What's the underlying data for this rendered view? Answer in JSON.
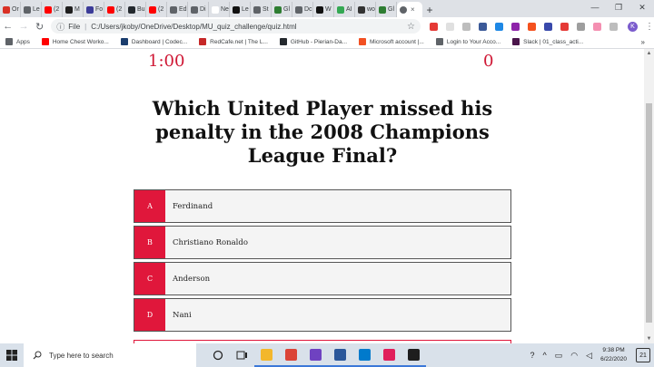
{
  "browser": {
    "tabs": [
      {
        "label": "Or",
        "color": "#d93025"
      },
      {
        "label": "Le",
        "color": "#5f6368"
      },
      {
        "label": "(2",
        "color": "#ff0000"
      },
      {
        "label": "M",
        "color": "#1f1f1f"
      },
      {
        "label": "Fo",
        "color": "#3b3b98"
      },
      {
        "label": "(2",
        "color": "#ff0000"
      },
      {
        "label": "Bu",
        "color": "#24292e"
      },
      {
        "label": "(2",
        "color": "#ff0000"
      },
      {
        "label": "Ed",
        "color": "#5f6368"
      },
      {
        "label": "Di",
        "color": "#5f6368"
      },
      {
        "label": "New T",
        "color": "#ffffff"
      },
      {
        "label": "Le",
        "color": "#111111"
      },
      {
        "label": "St",
        "color": "#5f6368"
      },
      {
        "label": "Gl",
        "color": "#2e7d32"
      },
      {
        "label": "Dc",
        "color": "#5f6368"
      },
      {
        "label": "W",
        "color": "#111111"
      },
      {
        "label": "AI",
        "color": "#34a853"
      },
      {
        "label": "wo",
        "color": "#333333"
      },
      {
        "label": "Gl",
        "color": "#2e7d32"
      }
    ],
    "active_tab": {
      "label": "",
      "close": "×"
    },
    "new_tab": "+",
    "url_label": "File",
    "url": "C:/Users/jkoby/OneDrive/Desktop/MU_quiz_challenge/quiz.html",
    "avatar": "K",
    "bookmarks": [
      {
        "label": "Apps",
        "color": "#5f6368"
      },
      {
        "label": "Home Chest Worko...",
        "color": "#ff0000"
      },
      {
        "label": "Dashboard | Codec...",
        "color": "#1a3d6d"
      },
      {
        "label": "RedCafe.net | The L...",
        "color": "#c62828"
      },
      {
        "label": "GitHub - Pierian-Da...",
        "color": "#24292e"
      },
      {
        "label": "Microsoft account |...",
        "color": "#f25022"
      },
      {
        "label": "Login to Your Acco...",
        "color": "#5f6368"
      },
      {
        "label": "Slack | 01_class_acti...",
        "color": "#4a154b"
      }
    ],
    "bookmarks_more": "»"
  },
  "quiz": {
    "timer": "1:00",
    "score": "0",
    "question": "Which United Player missed his penalty in the 2008 Champions League Final?",
    "options": [
      {
        "letter": "A",
        "text": "Ferdinand"
      },
      {
        "letter": "B",
        "text": "Christiano Ronaldo"
      },
      {
        "letter": "C",
        "text": "Anderson"
      },
      {
        "letter": "D",
        "text": "Nani"
      }
    ]
  },
  "taskbar": {
    "search_placeholder": "Type here to search",
    "time": "9:38 PM",
    "date": "6/22/2020",
    "notification_count": "21",
    "apps": [
      {
        "name": "file-explorer-icon",
        "color": "#f3b72c"
      },
      {
        "name": "chrome-icon",
        "color": "#db4437"
      },
      {
        "name": "github-desktop-icon",
        "color": "#6f42c1"
      },
      {
        "name": "word-icon",
        "color": "#2b579a"
      },
      {
        "name": "vscode-icon",
        "color": "#007acc"
      },
      {
        "name": "slack-icon",
        "color": "#e01e5a"
      },
      {
        "name": "terminal-icon",
        "color": "#1e1e1e"
      }
    ]
  },
  "colors": {
    "accent": "#e0173b",
    "timer": "#cf1734"
  }
}
